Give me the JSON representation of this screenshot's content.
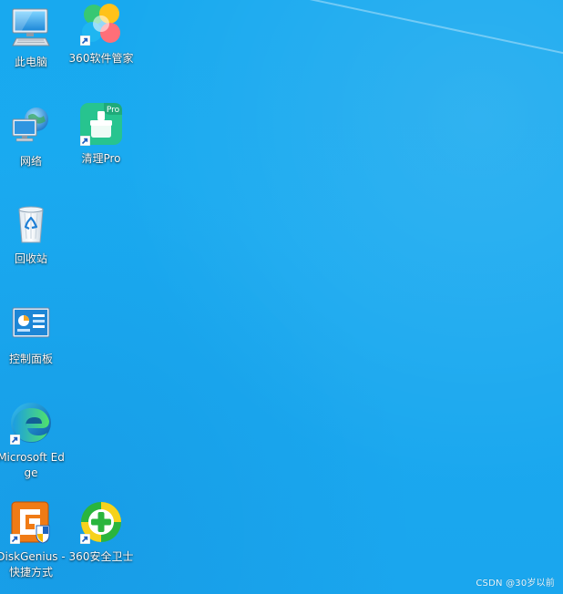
{
  "desktop": {
    "icons": [
      {
        "label": "此电脑",
        "icon": "computer-icon",
        "shortcut": false
      },
      {
        "label": "360软件管家",
        "icon": "360-software-manager-icon",
        "shortcut": true
      },
      {
        "label": "网络",
        "icon": "network-icon",
        "shortcut": false
      },
      {
        "label": "清理Pro",
        "icon": "cleaner-pro-icon",
        "shortcut": true,
        "badge": "Pro"
      },
      {
        "label": "回收站",
        "icon": "recycle-bin-icon",
        "shortcut": false
      },
      {
        "label": "控制面板",
        "icon": "control-panel-icon",
        "shortcut": false
      },
      {
        "label": "Microsoft Edge",
        "icon": "edge-icon",
        "shortcut": true
      },
      {
        "label": "DiskGenius - 快捷方式",
        "icon": "diskgenius-icon",
        "shortcut": true
      },
      {
        "label": "360安全卫士",
        "icon": "360-security-icon",
        "shortcut": true
      }
    ]
  },
  "watermark": "CSDN @30岁以前",
  "colors": {
    "wallpaper": "#1aa9ef",
    "label_text": "#ffffff",
    "cleaner_green": "#27c48f",
    "security_green": "#2ab53d",
    "security_yellow": "#f6d21b",
    "edge_blue": "#0f6fc6",
    "edge_green": "#37c35a",
    "diskgenius_orange": "#f07b15"
  }
}
